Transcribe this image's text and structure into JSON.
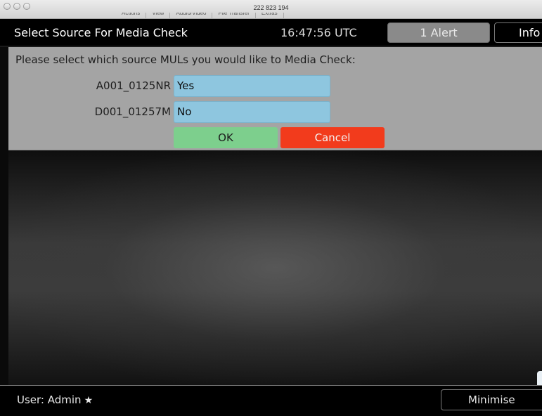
{
  "window": {
    "title": "222 823 194",
    "toolbar_items": [
      "Actions",
      "View",
      "Audio/Video",
      "File Transfer",
      "Extras"
    ]
  },
  "header": {
    "title": "Select Source For Media Check",
    "time": "16:47:56 UTC",
    "alert_label": "1 Alert",
    "info_label": "Info"
  },
  "dialog": {
    "prompt": "Please select which source MULs you would like to Media Check:",
    "rows": [
      {
        "label": "A001_0125NR",
        "value": "Yes"
      },
      {
        "label": "D001_01257M",
        "value": "No"
      }
    ],
    "ok_label": "OK",
    "cancel_label": "Cancel"
  },
  "footer": {
    "user_label": "User: Admin",
    "star_icon": "star-icon",
    "minimise_label": "Minimise"
  },
  "colors": {
    "header_bg": "#000000",
    "dialog_bg": "#a4a4a4",
    "field_bg": "#8ec6df",
    "ok_bg": "#7dcf8d",
    "cancel_bg": "#f23b1c",
    "alert_bg": "#8a8a8a"
  }
}
